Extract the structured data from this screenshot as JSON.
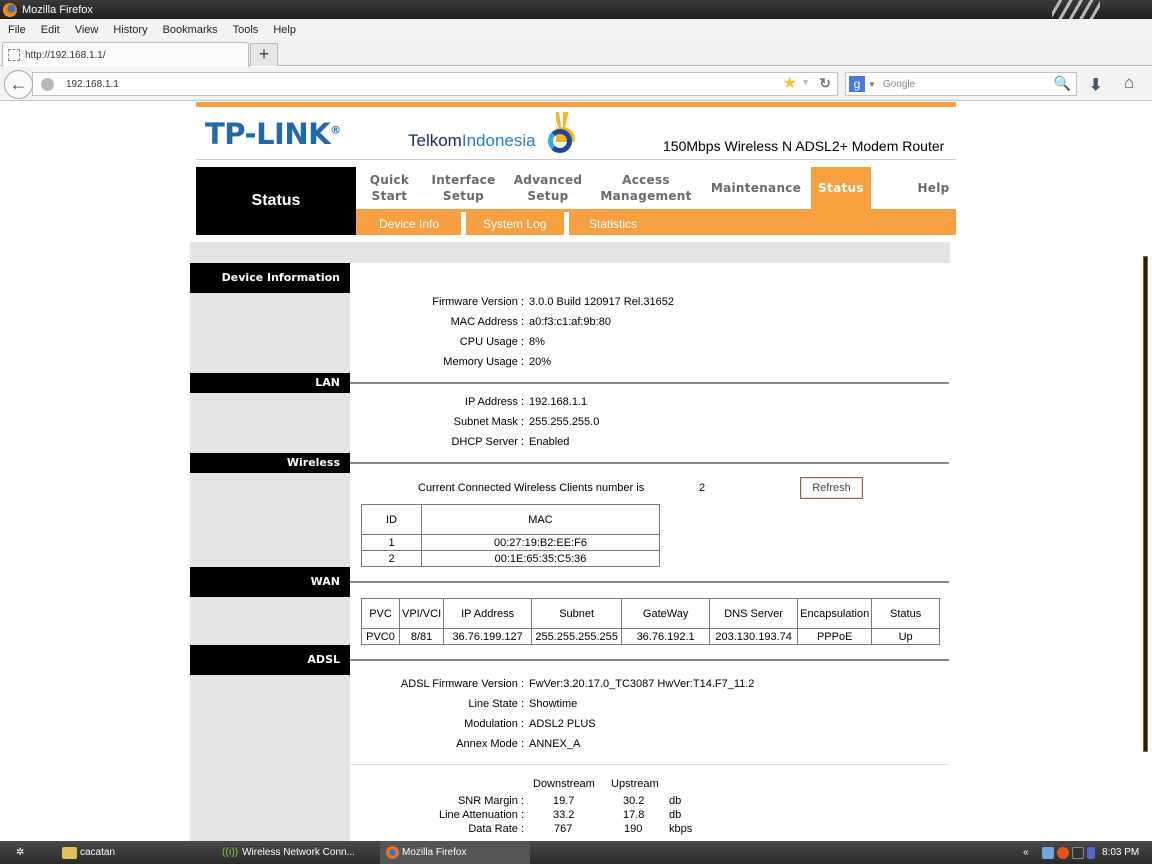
{
  "browser": {
    "window_title": "Mozilla Firefox",
    "menu": [
      "File",
      "Edit",
      "View",
      "History",
      "Bookmarks",
      "Tools",
      "Help"
    ],
    "tab_title": "http://192.168.1.1/",
    "new_tab": "+",
    "url": "192.168.1.1",
    "search_placeholder": "Google",
    "search_engine": "g"
  },
  "header": {
    "brand": "TP-LINK",
    "brand_mark": "®",
    "partner_bold": "Telkom",
    "partner_light": "Indonesia",
    "model": "150Mbps Wireless N ADSL2+ Modem Router",
    "accent_color": "#f7a042"
  },
  "nav": {
    "current_section": "Status",
    "items": [
      {
        "line1": "Quick",
        "line2": "Start"
      },
      {
        "line1": "Interface",
        "line2": "Setup"
      },
      {
        "line1": "Advanced",
        "line2": "Setup"
      },
      {
        "line1": "Access",
        "line2": "Management"
      },
      {
        "line1": "Maintenance",
        "line2": ""
      },
      {
        "line1": "Status",
        "line2": ""
      },
      {
        "line1": "Help",
        "line2": ""
      }
    ],
    "sub_items": [
      "Device Info",
      "System Log",
      "Statistics"
    ]
  },
  "sections": {
    "device_info": "Device Information",
    "lan": "LAN",
    "wireless": "Wireless",
    "wan": "WAN",
    "adsl": "ADSL"
  },
  "device": [
    {
      "label": "Firmware Version :",
      "value": "3.0.0 Build 120917 Rel.31652"
    },
    {
      "label": "MAC Address :",
      "value": "a0:f3:c1:af:9b:80"
    },
    {
      "label": "CPU Usage :",
      "value": "8%"
    },
    {
      "label": "Memory Usage :",
      "value": "20%"
    }
  ],
  "lan": [
    {
      "label": "IP Address :",
      "value": "192.168.1.1"
    },
    {
      "label": "Subnet Mask :",
      "value": "255.255.255.0"
    },
    {
      "label": "DHCP Server :",
      "value": "Enabled"
    }
  ],
  "wireless": {
    "clients_label": "Current Connected Wireless Clients number is",
    "clients_count": "2",
    "refresh_label": "Refresh",
    "headers": [
      "ID",
      "MAC"
    ],
    "rows": [
      [
        "1",
        "00:27:19:B2:EE:F6"
      ],
      [
        "2",
        "00:1E:65:35:C5:36"
      ]
    ]
  },
  "wan": {
    "headers": [
      "PVC",
      "VPI/VCI",
      "IP Address",
      "Subnet",
      "GateWay",
      "DNS Server",
      "Encapsulation",
      "Status"
    ],
    "rows": [
      [
        "PVC0",
        "8/81",
        "36.76.199.127",
        "255.255.255.255",
        "36.76.192.1",
        "203.130.193.74",
        "PPPoE",
        "Up"
      ]
    ]
  },
  "adsl": [
    {
      "label": "ADSL Firmware Version :",
      "value": "FwVer:3.20.17.0_TC3087 HwVer:T14.F7_11.2"
    },
    {
      "label": "Line State :",
      "value": "Showtime"
    },
    {
      "label": "Modulation :",
      "value": "ADSL2 PLUS"
    },
    {
      "label": "Annex Mode :",
      "value": "ANNEX_A"
    }
  ],
  "adsl_stats": {
    "col_down": "Downstream",
    "col_up": "Upstream",
    "rows": [
      {
        "label": "SNR Margin :",
        "down": "19.7",
        "up": "30.2",
        "unit": "db"
      },
      {
        "label": "Line Attenuation :",
        "down": "33.2",
        "up": "17.8",
        "unit": "db"
      },
      {
        "label": "Data Rate :",
        "down": "767",
        "up": "190",
        "unit": "kbps"
      }
    ]
  },
  "taskbar": {
    "items": [
      "cacatan",
      "Wireless Network Conn...",
      "Mozilla Firefox"
    ],
    "tray_chevron": "«",
    "clock": "8:03 PM"
  }
}
